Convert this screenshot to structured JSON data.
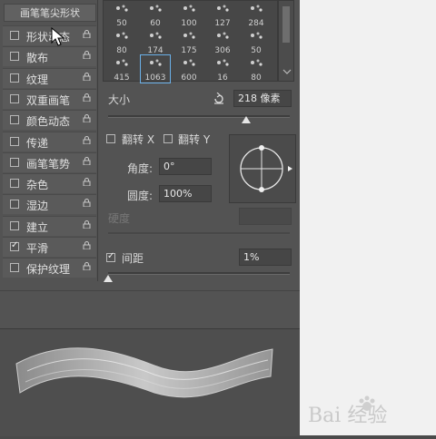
{
  "sidebar": {
    "title": "画笔笔尖形状",
    "items": [
      {
        "label": "形状动态",
        "checked": false
      },
      {
        "label": "散布",
        "checked": false
      },
      {
        "label": "纹理",
        "checked": false
      },
      {
        "label": "双重画笔",
        "checked": false
      },
      {
        "label": "颜色动态",
        "checked": false
      },
      {
        "label": "传递",
        "checked": false
      },
      {
        "label": "画笔笔势",
        "checked": false
      },
      {
        "label": "杂色",
        "checked": false
      },
      {
        "label": "湿边",
        "checked": false
      },
      {
        "label": "建立",
        "checked": false
      },
      {
        "label": "平滑",
        "checked": true
      },
      {
        "label": "保护纹理",
        "checked": false
      }
    ]
  },
  "brushes": [
    {
      "size": "50"
    },
    {
      "size": "60"
    },
    {
      "size": "100"
    },
    {
      "size": "127"
    },
    {
      "size": "284"
    },
    {
      "size": "80"
    },
    {
      "size": "174"
    },
    {
      "size": "175"
    },
    {
      "size": "306"
    },
    {
      "size": "50"
    },
    {
      "size": "415"
    },
    {
      "size": "1063",
      "selected": true
    },
    {
      "size": "600"
    },
    {
      "size": "16"
    },
    {
      "size": "80"
    }
  ],
  "size": {
    "label": "大小",
    "value": "218 像素",
    "slider_fraction": 0.76
  },
  "flip_x": {
    "label": "翻转 X",
    "checked": false
  },
  "flip_y": {
    "label": "翻转 Y",
    "checked": false
  },
  "angle": {
    "label": "角度:",
    "value": "0°"
  },
  "roundness": {
    "label": "圆度:",
    "value": "100%"
  },
  "hardness": {
    "label": "硬度"
  },
  "spacing": {
    "label": "间距",
    "value": "1%",
    "checked": true,
    "slider_fraction": 0.0
  },
  "colors": {
    "accent": "#6ab0e8",
    "panel": "#535353",
    "field": "#464646"
  },
  "watermark": "Bai 经验"
}
